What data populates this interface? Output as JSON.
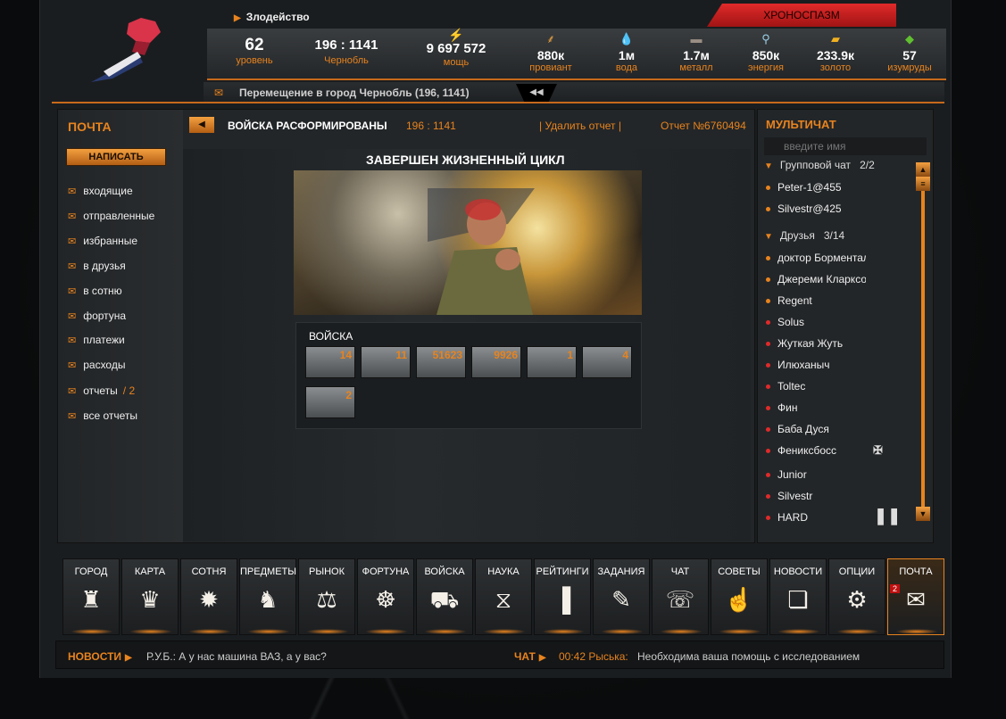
{
  "header": {
    "player_name": "Злодейство",
    "chrono_button": "ХРОНОСПАЗМ",
    "level": {
      "value": "62",
      "label": "уровень"
    },
    "location": {
      "value": "196 : 1141",
      "label": "Чернобль"
    },
    "power": {
      "value": "9 697 572",
      "label": "мощь"
    },
    "resources": [
      {
        "value": "880к",
        "label": "провиант",
        "icon": "wheat-icon"
      },
      {
        "value": "1м",
        "label": "вода",
        "icon": "water-icon"
      },
      {
        "value": "1.7м",
        "label": "металл",
        "icon": "metal-icon"
      },
      {
        "value": "850к",
        "label": "энергия",
        "icon": "energy-icon"
      },
      {
        "value": "233.9к",
        "label": "золото",
        "icon": "gold-icon"
      },
      {
        "value": "57",
        "label": "изумруды",
        "icon": "emerald-icon"
      }
    ],
    "movement_text": "Перемещение в город Чернобль (196, 1141)"
  },
  "mail": {
    "title": "ПОЧТА",
    "compose_label": "НАПИСАТЬ",
    "folders": [
      {
        "label": "входящие",
        "count": ""
      },
      {
        "label": "отправленные",
        "count": ""
      },
      {
        "label": "избранные",
        "count": ""
      },
      {
        "label": "в друзья",
        "count": ""
      },
      {
        "label": "в сотню",
        "count": ""
      },
      {
        "label": "фортуна",
        "count": ""
      },
      {
        "label": "платежи",
        "count": ""
      },
      {
        "label": "расходы",
        "count": ""
      },
      {
        "label": "отчеты",
        "count": "/ 2"
      },
      {
        "label": "все отчеты",
        "count": ""
      }
    ],
    "report": {
      "title": "ВОЙСКА РАСФОРМИРОВАНЫ",
      "coords": "196 : 1141",
      "delete_label": "| Удалить отчет |",
      "number": "Отчет №6760494",
      "heading": "ЗАВЕРШЕН ЖИЗНЕННЫЙ ЦИКЛ",
      "troops_label": "ВОЙСКА",
      "units": [
        "14",
        "11",
        "51623",
        "9926",
        "1",
        "4",
        "2"
      ]
    }
  },
  "chat": {
    "title": "МУЛЬТИЧАТ",
    "search_placeholder": "введите имя",
    "group_chat": {
      "label": "Групповой чат",
      "count": "2/2"
    },
    "group_members": [
      "Peter-1@455",
      "Silvestr@425"
    ],
    "friends_group": {
      "label": "Друзья",
      "count": "3/14"
    },
    "friends": [
      {
        "name": "доктор Борменталь",
        "online": true
      },
      {
        "name": "Джереми Кларксон",
        "online": true
      },
      {
        "name": "Regent",
        "online": true
      },
      {
        "name": "Solus",
        "online": false
      },
      {
        "name": "Жуткая Жуть",
        "online": false
      },
      {
        "name": "Илюханыч",
        "online": false
      },
      {
        "name": "Toltec",
        "online": false
      },
      {
        "name": "Фин",
        "online": false
      },
      {
        "name": "Баба Дуся",
        "online": false
      },
      {
        "name": "Фениксбосс",
        "online": false
      },
      {
        "name": "Junior",
        "online": false
      },
      {
        "name": "Silvestr",
        "online": false
      },
      {
        "name": "HARD",
        "online": false
      }
    ]
  },
  "nav": [
    {
      "label": "ГОРОД",
      "icon": "torch-icon",
      "glyph": "♜"
    },
    {
      "label": "КАРТА",
      "icon": "emblem-icon",
      "glyph": "♛"
    },
    {
      "label": "СОТНЯ",
      "icon": "mace-icon",
      "glyph": "✹"
    },
    {
      "label": "ПРЕДМЕТЫ",
      "icon": "items-icon",
      "glyph": "♞"
    },
    {
      "label": "РЫНОК",
      "icon": "market-icon",
      "glyph": "⚖"
    },
    {
      "label": "ФОРТУНА",
      "icon": "wheel-icon",
      "glyph": "☸"
    },
    {
      "label": "ВОЙСКА",
      "icon": "tank-icon",
      "glyph": "⛟"
    },
    {
      "label": "НАУКА",
      "icon": "dna-icon",
      "glyph": "⧖"
    },
    {
      "label": "РЕЙТИНГИ",
      "icon": "ratings-icon",
      "glyph": "▐"
    },
    {
      "label": "ЗАДАНИЯ",
      "icon": "quest-icon",
      "glyph": "✎"
    },
    {
      "label": "ЧАТ",
      "icon": "handshake-icon",
      "glyph": "☏"
    },
    {
      "label": "СОВЕТЫ",
      "icon": "advice-icon",
      "glyph": "☝"
    },
    {
      "label": "НОВОСТИ",
      "icon": "news-icon",
      "glyph": "❏"
    },
    {
      "label": "ОПЦИИ",
      "icon": "gear-icon",
      "glyph": "⚙"
    },
    {
      "label": "ПОЧТА",
      "icon": "mail-icon",
      "glyph": "✉",
      "badge": "2"
    }
  ],
  "ticker": {
    "news_label": "НОВОСТИ",
    "news_text": "Р.У.Б.: А у нас машина ВАЗ, а у вас?",
    "chat_label": "ЧАТ",
    "chat_time": "00:42 Рыська:",
    "chat_text": "Необходима ваша помощь с исследованием"
  }
}
